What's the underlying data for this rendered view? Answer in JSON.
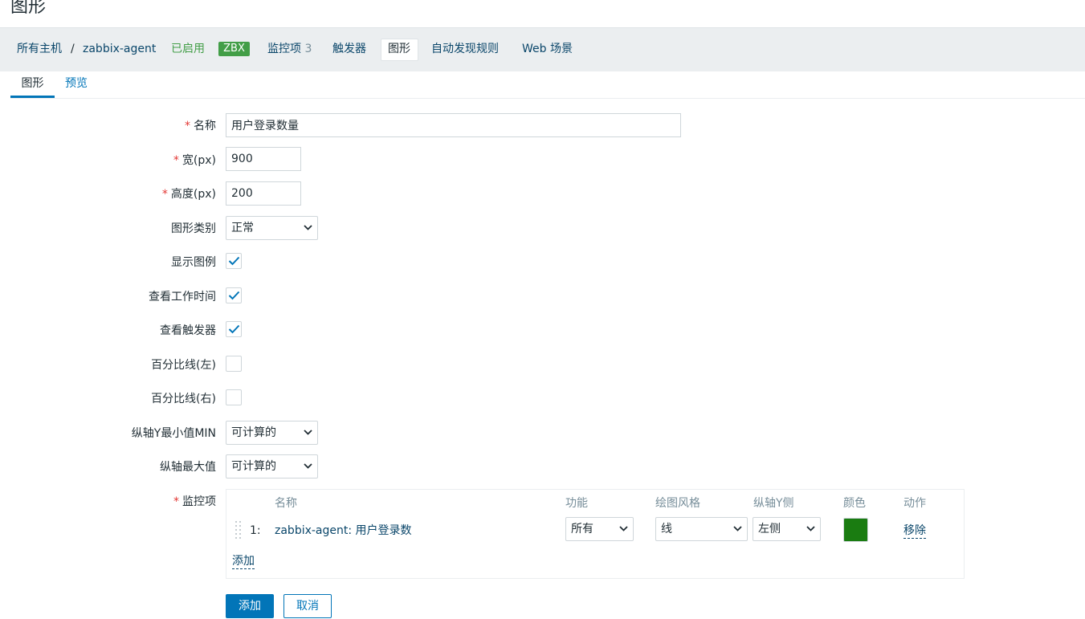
{
  "page": {
    "title": "图形"
  },
  "host_nav": {
    "all_hosts": "所有主机",
    "separator": "/",
    "host_name": "zabbix-agent",
    "status": "已启用",
    "availability_badge": "ZBX",
    "items_label": "监控项",
    "items_count": "3",
    "triggers_label": "触发器",
    "graphs_label": "图形",
    "discovery_label": "自动发现规则",
    "web_label": "Web 场景",
    "status_color": "#429e47"
  },
  "tabs": [
    {
      "label": "图形",
      "active": true
    },
    {
      "label": "预览",
      "active": false
    }
  ],
  "form": {
    "name": {
      "label": "名称",
      "required": true,
      "value": "用户登录数量"
    },
    "width": {
      "label": "宽(px)",
      "required": true,
      "value": "900"
    },
    "height": {
      "label": "高度(px)",
      "required": true,
      "value": "200"
    },
    "graph_type": {
      "label": "图形类别",
      "value": "正常"
    },
    "show_legend": {
      "label": "显示图例",
      "checked": true
    },
    "show_working_time": {
      "label": "查看工作时间",
      "checked": true
    },
    "show_triggers": {
      "label": "查看触发器",
      "checked": true
    },
    "percentile_left": {
      "label": "百分比线(左)",
      "checked": false
    },
    "percentile_right": {
      "label": "百分比线(右)",
      "checked": false
    },
    "y_min": {
      "label": "纵轴Y最小值MIN",
      "value": "可计算的"
    },
    "y_max": {
      "label": "纵轴最大值",
      "value": "可计算的"
    },
    "items": {
      "label": "监控项",
      "required": true,
      "headers": {
        "name": "名称",
        "function": "功能",
        "draw_style": "绘图风格",
        "y_axis_side": "纵轴Y侧",
        "color": "颜色",
        "action": "动作"
      },
      "rows": [
        {
          "index": "1:",
          "name": "zabbix-agent: 用户登录数",
          "function": "所有",
          "draw_style": "线",
          "y_axis_side": "左侧",
          "color": "#1a7c11",
          "action": "移除"
        }
      ],
      "add_label": "添加"
    },
    "buttons": {
      "add": "添加",
      "cancel": "取消"
    }
  },
  "colors": {
    "accent": "#0275b8",
    "required": "#e33734",
    "link": "#0a466a"
  }
}
